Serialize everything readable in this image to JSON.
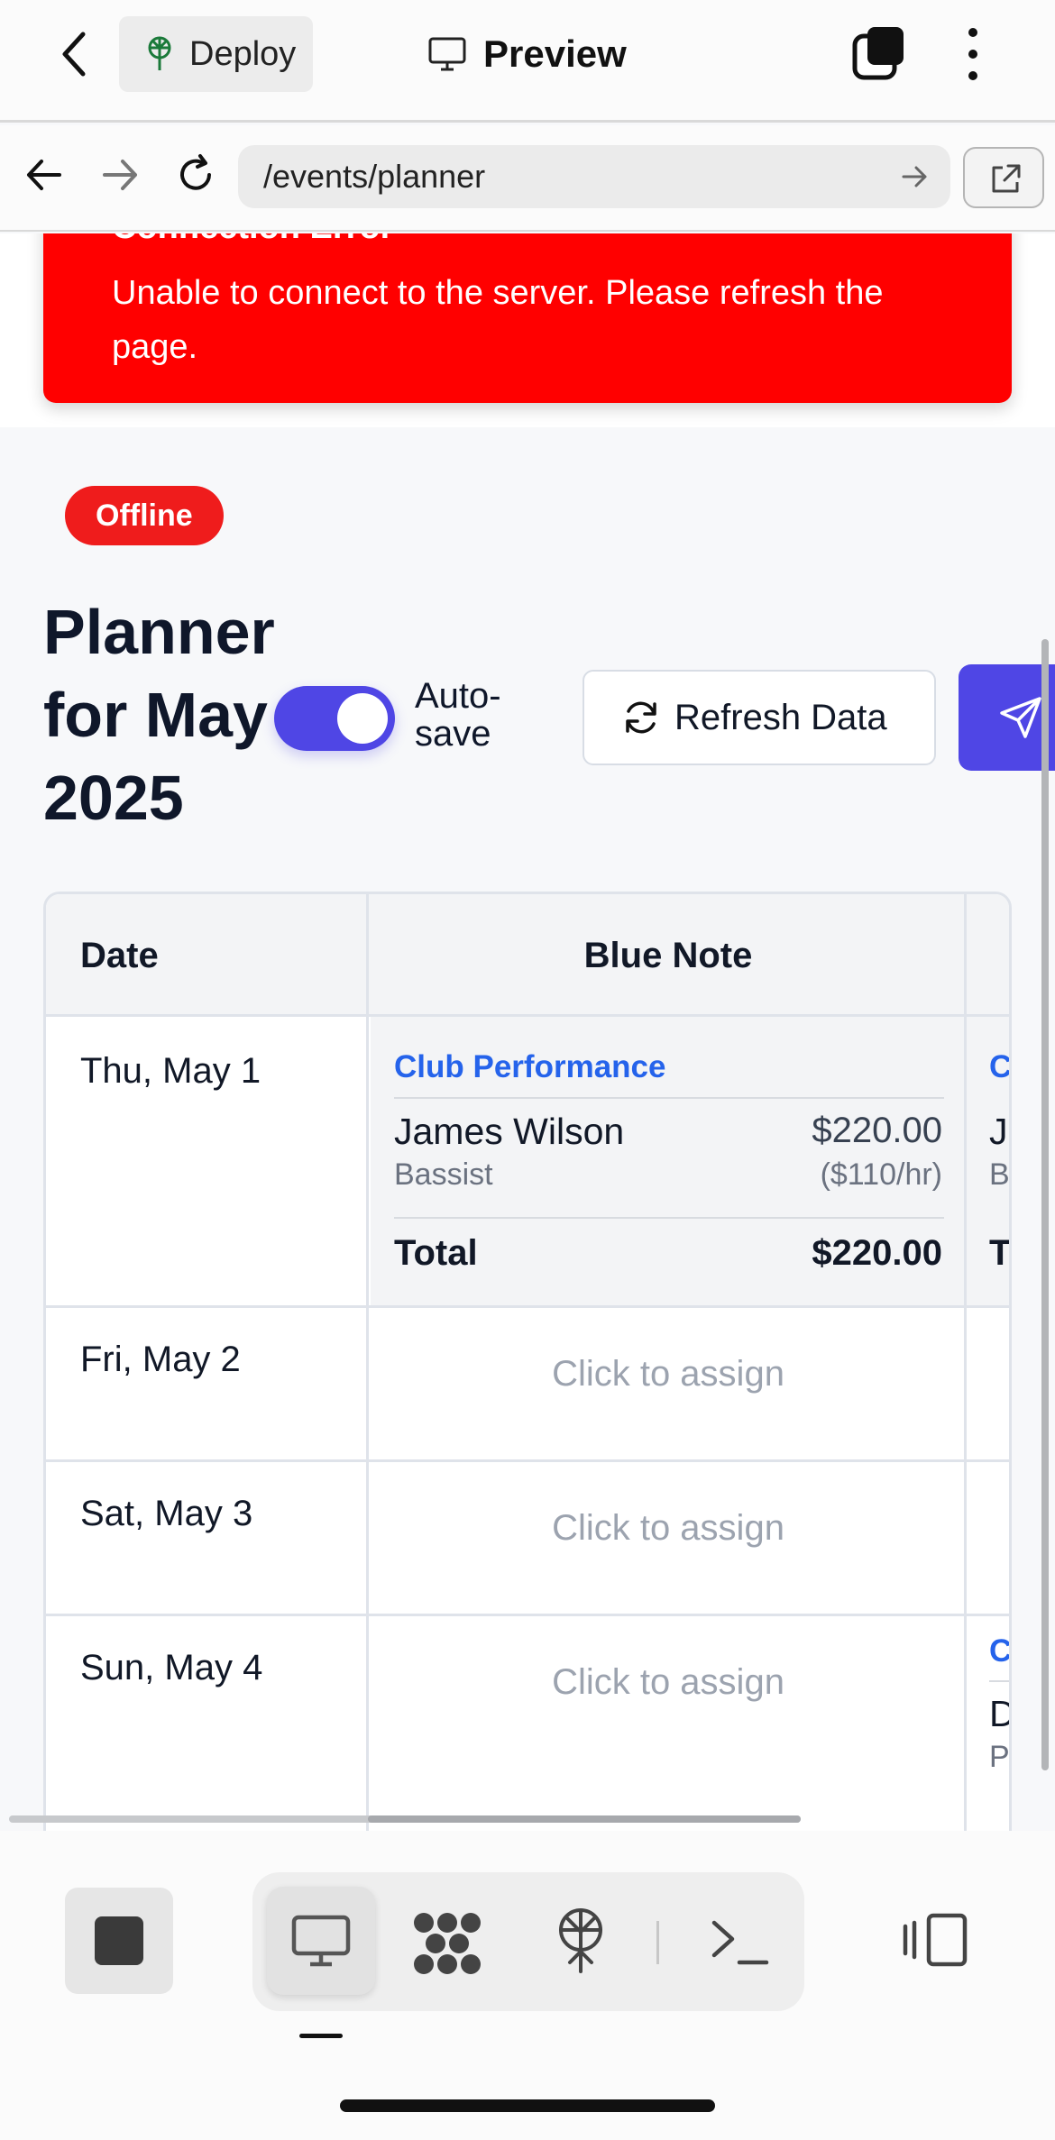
{
  "app_bar": {
    "deploy_label": "Deploy",
    "preview_label": "Preview"
  },
  "browser": {
    "url": "/events/planner"
  },
  "error_toast": {
    "title": "Connection Error",
    "message": "Unable to connect to the server. Please refresh the page."
  },
  "status_badge": "Offline",
  "planner": {
    "title": "Planner for May 2025",
    "autosave_label": "Auto-save",
    "autosave_on": true,
    "refresh_label": "Refresh Data"
  },
  "table": {
    "date_header": "Date",
    "venue_header": "Blue Note",
    "rows": [
      {
        "date": "Thu, May 1"
      },
      {
        "date": "Fri, May 2",
        "blue_note": "Click to assign"
      },
      {
        "date": "Sat, May 3",
        "blue_note": "Click to assign"
      },
      {
        "date": "Sun, May 4",
        "blue_note": "Click to assign"
      }
    ],
    "booking": {
      "event": "Club Performance",
      "musician": "James Wilson",
      "role": "Bassist",
      "amount": "$220.00",
      "rate": "($110/hr)",
      "total_label": "Total",
      "total_value": "$220.00"
    },
    "partial_col": {
      "event_initial": "C",
      "name_initial": "J",
      "role_initial": "B",
      "total_initial": "T",
      "row4_event_initial": "C",
      "row4_name_initial": "D",
      "row4_role_initial": "P"
    }
  },
  "colors": {
    "accent": "#4f46e5",
    "error": "#ff0000",
    "badge": "#ef1c1c",
    "link": "#2563eb"
  },
  "icons": [
    "back-chevron-icon",
    "deploy-icon",
    "monitor-icon",
    "windows-icon",
    "more-vertical-icon",
    "arrow-left-icon",
    "arrow-right-icon",
    "reload-icon",
    "go-arrow-icon",
    "external-link-icon",
    "refresh-icon",
    "send-icon",
    "stop-icon",
    "desktop-icon",
    "grid-blob-icon",
    "deploy-tree-icon",
    "terminal-icon",
    "device-toggle-icon"
  ]
}
